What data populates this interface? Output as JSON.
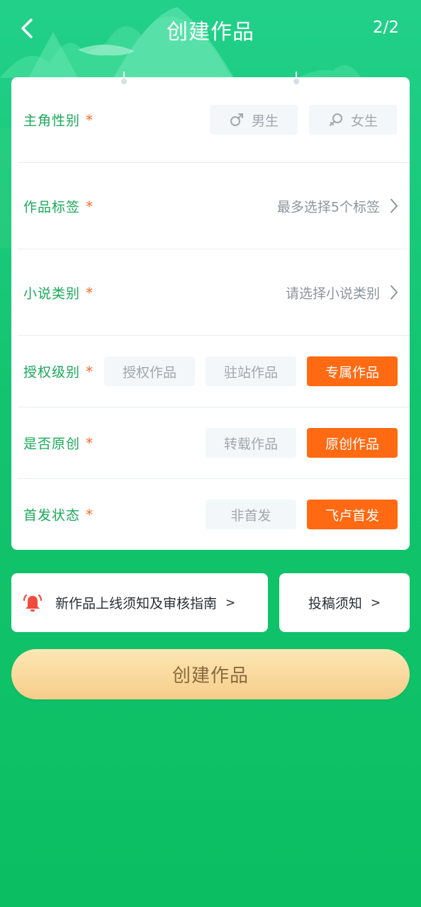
{
  "header": {
    "title": "创建作品",
    "step": "2/2"
  },
  "form": {
    "gender": {
      "label": "主角性别",
      "required_mark": "*",
      "options": [
        "男生",
        "女生"
      ]
    },
    "tags": {
      "label": "作品标签",
      "required_mark": "*",
      "placeholder": "最多选择5个标签"
    },
    "category": {
      "label": "小说类别",
      "required_mark": "*",
      "placeholder": "请选择小说类别"
    },
    "license": {
      "label": "授权级别",
      "required_mark": "*",
      "options": [
        "授权作品",
        "驻站作品",
        "专属作品"
      ],
      "selected": "专属作品"
    },
    "original": {
      "label": "是否原创",
      "required_mark": "*",
      "options": [
        "转载作品",
        "原创作品"
      ],
      "selected": "原创作品"
    },
    "first_publish": {
      "label": "首发状态",
      "required_mark": "*",
      "options": [
        "非首发",
        "飞卢首发"
      ],
      "selected": "飞卢首发"
    }
  },
  "notices": {
    "guide": {
      "text": "新作品上线须知及审核指南",
      "arrow": ">"
    },
    "submission": {
      "text": "投稿须知",
      "arrow": ">"
    }
  },
  "submit_button": "创建作品",
  "colors": {
    "background": "#12c46e",
    "label_green": "#1aa95b",
    "required_orange": "#ff6a2b",
    "selected_orange": "#ff6a13",
    "unselected_bg": "#f3f7fa",
    "submit_gold": "#f6cd8a",
    "bell_red": "#f04b3c"
  }
}
